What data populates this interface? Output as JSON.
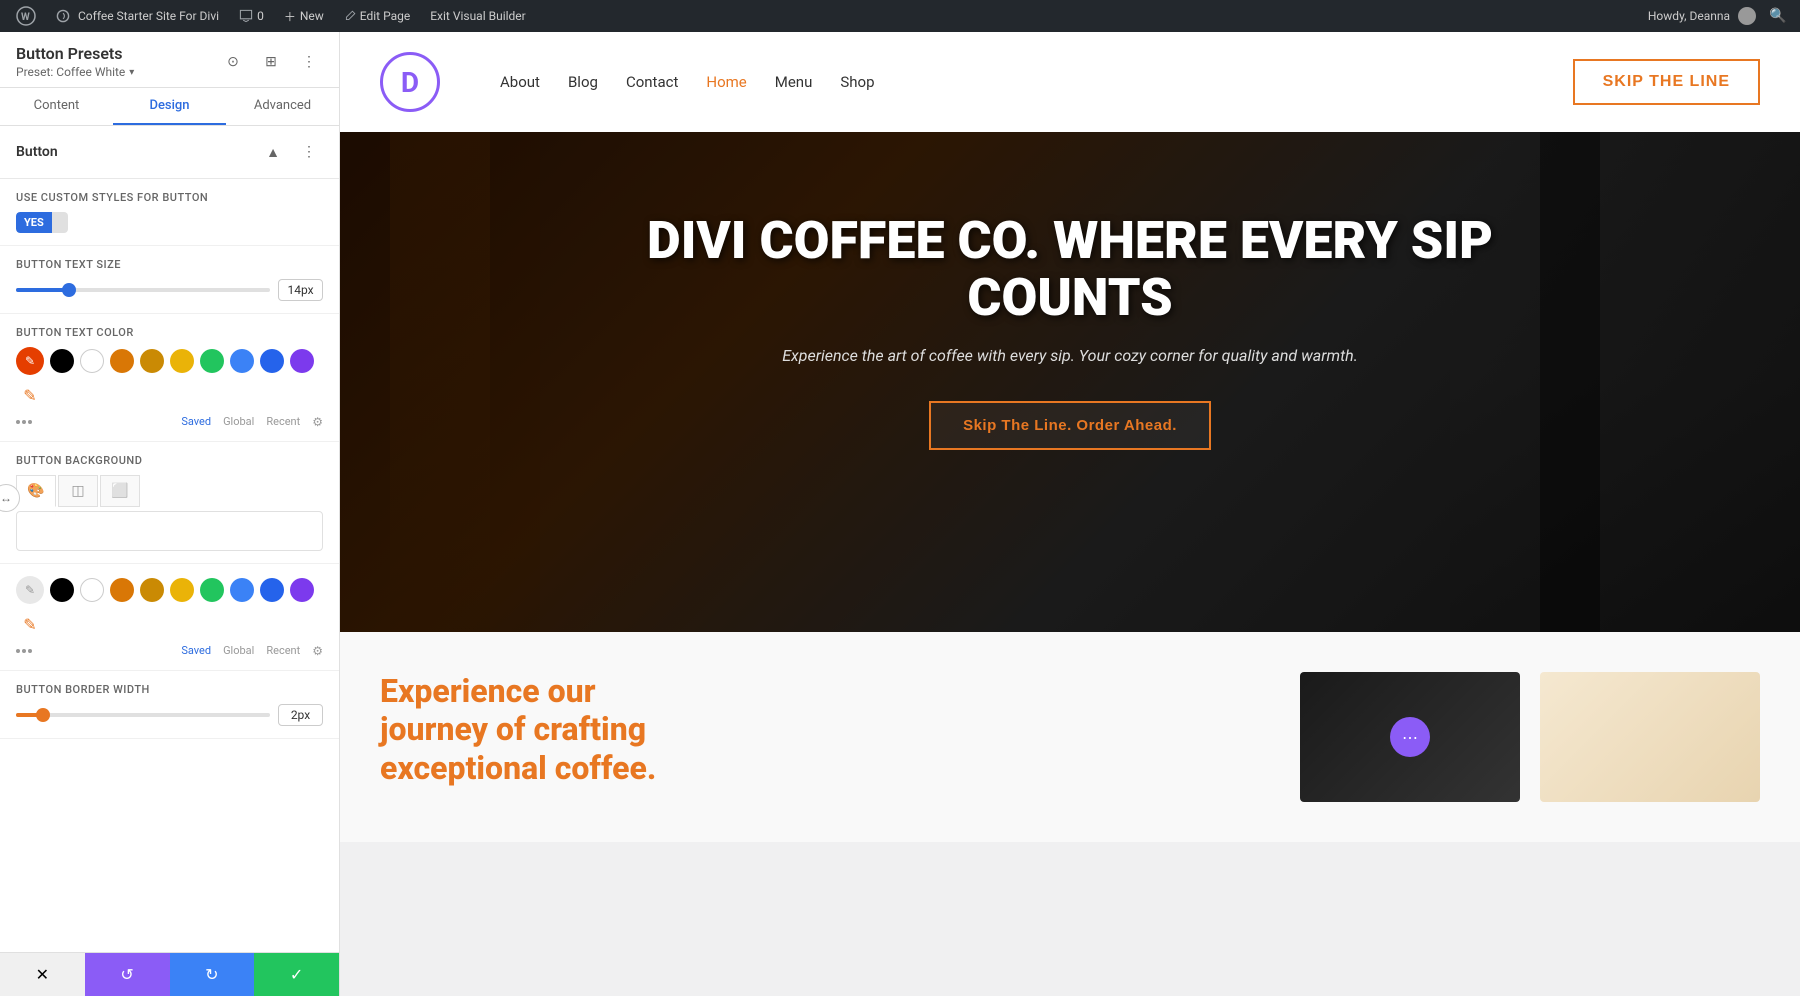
{
  "admin_bar": {
    "site_name": "Coffee Starter Site For Divi",
    "comments_count": "0",
    "new_label": "New",
    "edit_page_label": "Edit Page",
    "exit_builder_label": "Exit Visual Builder",
    "howdy": "Howdy, Deanna",
    "search_icon": "search"
  },
  "left_panel": {
    "title": "Button Presets",
    "subtitle": "Preset: Coffee White",
    "tabs": [
      {
        "label": "Content",
        "id": "content"
      },
      {
        "label": "Design",
        "id": "design",
        "active": true
      },
      {
        "label": "Advanced",
        "id": "advanced"
      }
    ],
    "section_title": "Button",
    "toggle_label": "Use Custom Styles For Button",
    "toggle_yes": "YES",
    "button_text_size_label": "Button Text Size",
    "button_text_size_value": "14px",
    "button_text_size_pct": 20,
    "button_text_color_label": "Button Text Color",
    "button_background_label": "Button Background",
    "button_border_width_label": "Button Border Width",
    "button_border_width_value": "2px",
    "button_border_width_pct": 10,
    "color_tags": {
      "saved": "Saved",
      "global": "Global",
      "recent": "Recent"
    },
    "colors": [
      {
        "id": "red",
        "hex": "#e53e00",
        "active": true
      },
      {
        "id": "black",
        "hex": "#000000"
      },
      {
        "id": "white",
        "hex": "#ffffff"
      },
      {
        "id": "orange",
        "hex": "#d97706"
      },
      {
        "id": "yellow-orange",
        "hex": "#ca8a04"
      },
      {
        "id": "yellow",
        "hex": "#eab308"
      },
      {
        "id": "green",
        "hex": "#22c55e"
      },
      {
        "id": "blue-mid",
        "hex": "#3b82f6"
      },
      {
        "id": "blue-dark",
        "hex": "#2563eb"
      },
      {
        "id": "purple",
        "hex": "#7c3aed"
      }
    ],
    "colors2": [
      {
        "id": "black2",
        "hex": "#000000"
      },
      {
        "id": "white2",
        "hex": "#ffffff"
      },
      {
        "id": "orange2",
        "hex": "#d97706"
      },
      {
        "id": "yellow-orange2",
        "hex": "#ca8a04"
      },
      {
        "id": "yellow2",
        "hex": "#eab308"
      },
      {
        "id": "green2",
        "hex": "#22c55e"
      },
      {
        "id": "blue-mid2",
        "hex": "#3b82f6"
      },
      {
        "id": "blue-dark2",
        "hex": "#2563eb"
      },
      {
        "id": "purple2",
        "hex": "#7c3aed"
      }
    ],
    "bottom_toolbar": {
      "cancel": "✕",
      "undo": "↺",
      "redo": "↻",
      "save": "✓"
    }
  },
  "site": {
    "logo_letter": "D",
    "nav_items": [
      {
        "label": "About",
        "active": false
      },
      {
        "label": "Blog",
        "active": false
      },
      {
        "label": "Contact",
        "active": false
      },
      {
        "label": "Home",
        "active": true
      },
      {
        "label": "Menu",
        "active": false
      },
      {
        "label": "Shop",
        "active": false
      }
    ],
    "skip_line_btn": "Skip the Line",
    "hero_title_line1": "DIVI COFFEE CO. WHERE EVERY SIP",
    "hero_title_line2": "COUNTS",
    "hero_subtitle": "Experience the art of coffee with every sip. Your cozy corner for quality and warmth.",
    "hero_cta": "Skip The Line. Order Ahead.",
    "below_hero_title_line1": "Experience our",
    "below_hero_title_line2": "journey of crafting",
    "below_hero_title_line3": "exceptional coffee."
  }
}
